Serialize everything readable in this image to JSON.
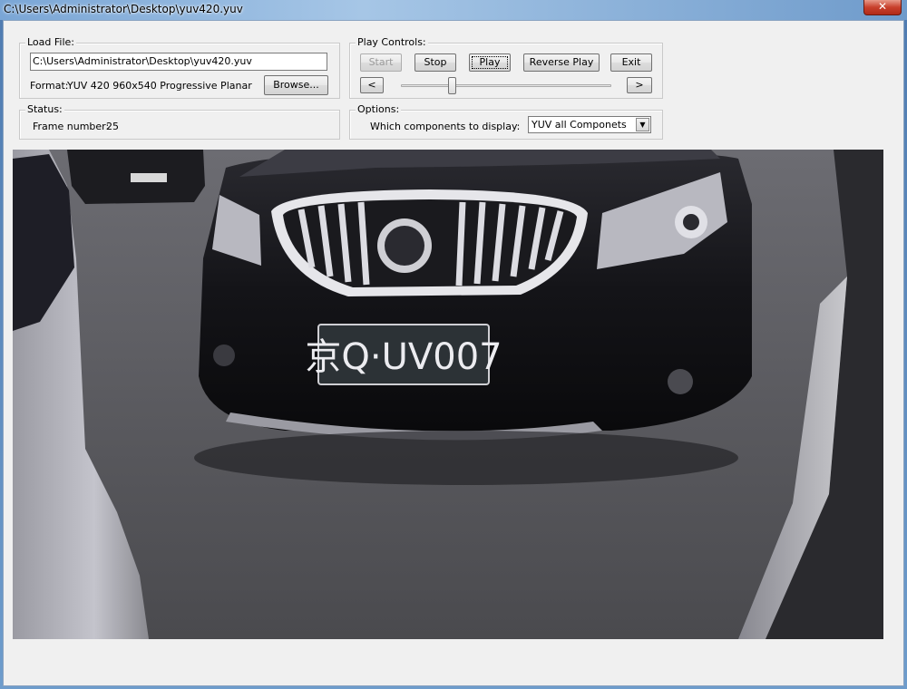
{
  "window": {
    "title": "C:\\Users\\Administrator\\Desktop\\yuv420.yuv",
    "close_label": "✕"
  },
  "load_file": {
    "group_label": "Load File:",
    "path_value": "C:\\Users\\Administrator\\Desktop\\yuv420.yuv",
    "format_label": "Format:",
    "format_value": "YUV 420  960x540 Progressive Planar",
    "browse_label": "Browse..."
  },
  "play_controls": {
    "group_label": "Play Controls:",
    "start_label": "Start",
    "stop_label": "Stop",
    "play_label": "Play",
    "reverse_label": "Reverse Play",
    "exit_label": "Exit",
    "prev_label": "<",
    "next_label": ">",
    "slider_position_fraction": 0.24
  },
  "status": {
    "group_label": "Status:",
    "frame_label": "Frame number:",
    "frame_value": "25"
  },
  "options": {
    "group_label": "Options:",
    "components_label": "Which components to display:",
    "components_selected": "YUV all Componets"
  },
  "video": {
    "plate_text": "京Q·UV007"
  },
  "colors": {
    "dialog_bg": "#f0f0f0",
    "close_button": "#c8402c",
    "title_bar": "#7aa6d6"
  }
}
